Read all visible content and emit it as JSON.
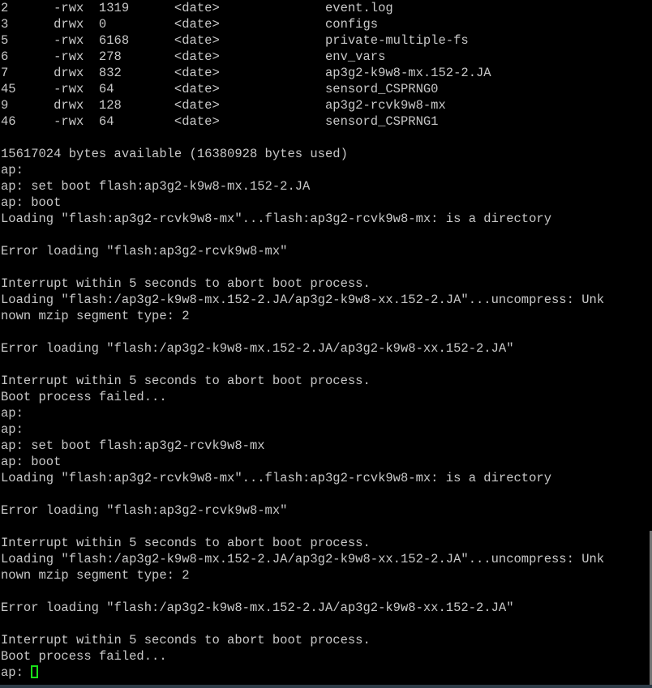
{
  "terminal": {
    "prompt": "ap:",
    "cursor_color": "#19e019",
    "text_color": "#c8c8c8",
    "background_color": "#000000",
    "columns": 80,
    "file_listing": {
      "rows": [
        {
          "index": "2",
          "permissions": "-rwx",
          "size": "1319",
          "date": "<date>",
          "name": "event.log"
        },
        {
          "index": "3",
          "permissions": "drwx",
          "size": "0",
          "date": "<date>",
          "name": "configs"
        },
        {
          "index": "5",
          "permissions": "-rwx",
          "size": "6168",
          "date": "<date>",
          "name": "private-multiple-fs"
        },
        {
          "index": "6",
          "permissions": "-rwx",
          "size": "278",
          "date": "<date>",
          "name": "env_vars"
        },
        {
          "index": "7",
          "permissions": "drwx",
          "size": "832",
          "date": "<date>",
          "name": "ap3g2-k9w8-mx.152-2.JA"
        },
        {
          "index": "45",
          "permissions": "-rwx",
          "size": "64",
          "date": "<date>",
          "name": "sensord_CSPRNG0"
        },
        {
          "index": "9",
          "permissions": "drwx",
          "size": "128",
          "date": "<date>",
          "name": "ap3g2-rcvk9w8-mx"
        },
        {
          "index": "46",
          "permissions": "-rwx",
          "size": "64",
          "date": "<date>",
          "name": "sensord_CSPRNG1"
        }
      ]
    },
    "storage_summary": {
      "bytes_available": "15617024",
      "bytes_used": "16380928",
      "text": "15617024 bytes available (16380928 bytes used)"
    },
    "lines": [
      "2      -rwx  1319      <date>              event.log",
      "3      drwx  0         <date>              configs",
      "5      -rwx  6168      <date>              private-multiple-fs",
      "6      -rwx  278       <date>              env_vars",
      "7      drwx  832       <date>              ap3g2-k9w8-mx.152-2.JA",
      "45     -rwx  64        <date>              sensord_CSPRNG0",
      "9      drwx  128       <date>              ap3g2-rcvk9w8-mx",
      "46     -rwx  64        <date>              sensord_CSPRNG1",
      "",
      "15617024 bytes available (16380928 bytes used)",
      "ap:",
      "ap: set boot flash:ap3g2-k9w8-mx.152-2.JA",
      "ap: boot",
      "Loading \"flash:ap3g2-rcvk9w8-mx\"...flash:ap3g2-rcvk9w8-mx: is a directory",
      "",
      "Error loading \"flash:ap3g2-rcvk9w8-mx\"",
      "",
      "Interrupt within 5 seconds to abort boot process.",
      "Loading \"flash:/ap3g2-k9w8-mx.152-2.JA/ap3g2-k9w8-xx.152-2.JA\"...uncompress: Unk",
      "nown mzip segment type: 2",
      "",
      "Error loading \"flash:/ap3g2-k9w8-mx.152-2.JA/ap3g2-k9w8-xx.152-2.JA\"",
      "",
      "Interrupt within 5 seconds to abort boot process.",
      "Boot process failed...",
      "ap:",
      "ap:",
      "ap: set boot flash:ap3g2-rcvk9w8-mx",
      "ap: boot",
      "Loading \"flash:ap3g2-rcvk9w8-mx\"...flash:ap3g2-rcvk9w8-mx: is a directory",
      "",
      "Error loading \"flash:ap3g2-rcvk9w8-mx\"",
      "",
      "Interrupt within 5 seconds to abort boot process.",
      "Loading \"flash:/ap3g2-k9w8-mx.152-2.JA/ap3g2-k9w8-xx.152-2.JA\"...uncompress: Unk",
      "nown mzip segment type: 2",
      "",
      "Error loading \"flash:/ap3g2-k9w8-mx.152-2.JA/ap3g2-k9w8-xx.152-2.JA\"",
      "",
      "Interrupt within 5 seconds to abort boot process.",
      "Boot process failed..."
    ],
    "final_prompt": "ap: "
  }
}
